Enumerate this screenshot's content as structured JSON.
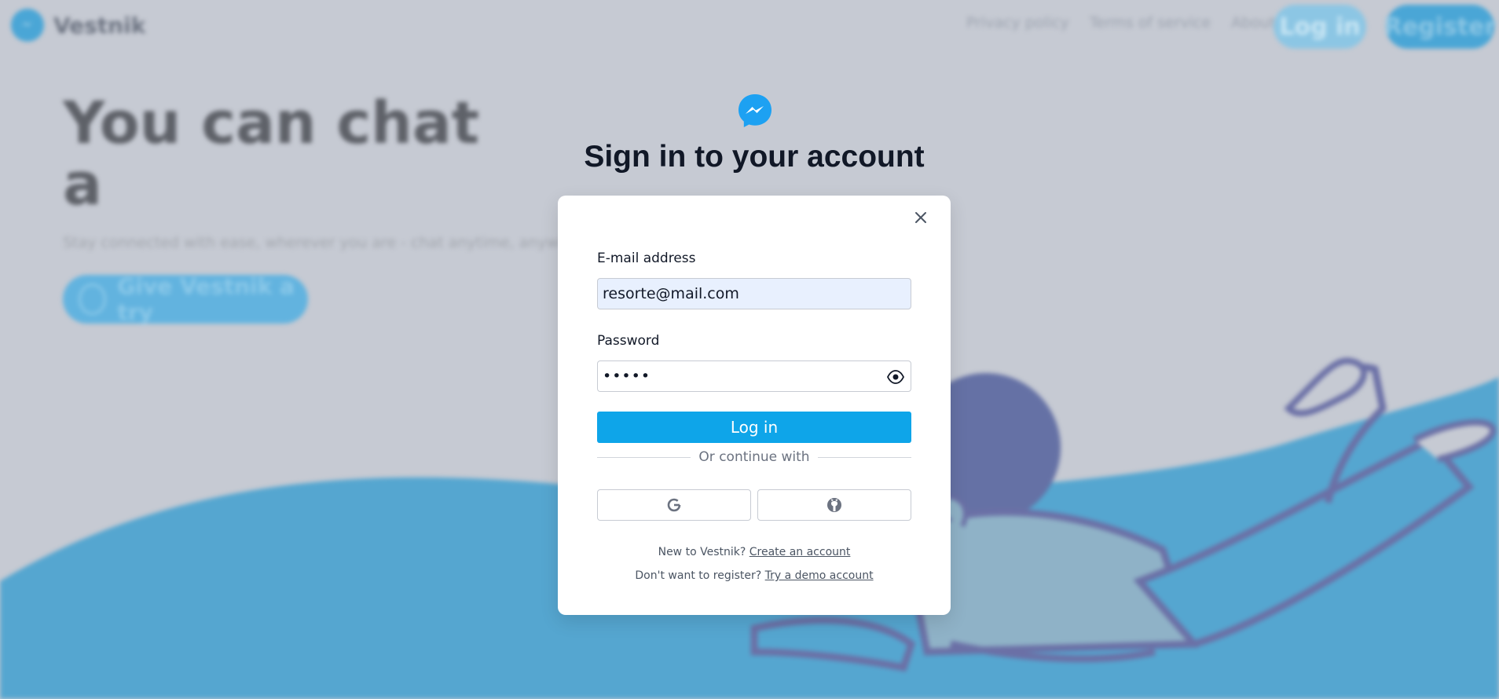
{
  "app": {
    "brand": "Vestnik"
  },
  "nav": {
    "links": [
      "Privacy policy",
      "Terms of service",
      "About"
    ],
    "login_label": "Log in",
    "register_label": "Register"
  },
  "hero": {
    "title_line1": "You can chat",
    "title_line2": "a",
    "subtitle": "Stay connected with ease, wherever you are - chat anytime, anywhere, d",
    "cta_label": "Give Vestnik a try"
  },
  "dialog": {
    "title": "Sign in to your account",
    "email_label": "E-mail address",
    "email_value": "resorte@mail.com",
    "password_label": "Password",
    "password_value": "•••••",
    "login_label": "Log in",
    "divider_text": "Or continue with",
    "google_icon": "google-icon",
    "github_icon": "github-icon",
    "new_prompt": "New to Vestnik?",
    "create_link": "Create an account",
    "demo_prompt": "Don't want to register?",
    "demo_link": "Try a demo account"
  },
  "colors": {
    "accent": "#0ea5e9",
    "background_blue": "#55a6d0",
    "illustration": "#6b70a6"
  }
}
